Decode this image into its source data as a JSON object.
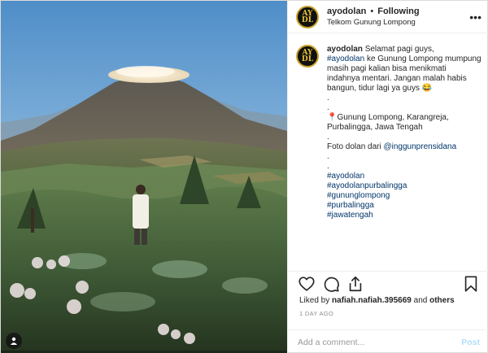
{
  "header": {
    "username": "ayodolan",
    "separator": "•",
    "follow_status": "Following",
    "location": "Telkom Gunung Lompong",
    "more_icon": "more-horizontal-icon"
  },
  "caption": {
    "author": "ayodolan",
    "text_1": "Selamat pagi guys,",
    "mention_hashtag": "#ayodolan",
    "text_2": "ke Gunung Lompong mumpung masih pagi kalian bisa menikmati indahnya mentari. Jangan malah habis bangun, tidur lagi ya guys 😂",
    "dot_1": ".",
    "dot_2": ".",
    "location_pin": "📍",
    "location_text": "Gunung Lompong, Karangreja, Purbalingga, Jawa Tengah",
    "dot_3": ".",
    "credit_text": "Foto dolan dari",
    "credit_user": "@inggunprensidana",
    "dot_4": ".",
    "dot_5": ".",
    "hashtags": [
      "#ayodolan",
      "#ayodolanpurbalingga",
      "#gununglompong",
      "#purbalingga",
      "#jawatengah"
    ]
  },
  "actions": {
    "like_icon": "heart-icon",
    "comment_icon": "comment-icon",
    "share_icon": "share-icon",
    "save_icon": "bookmark-icon"
  },
  "likes": {
    "prefix": "Liked by",
    "user": "nafiah.nafiah.395669",
    "suffix": "and",
    "others": "others"
  },
  "timestamp": "1 DAY AGO",
  "comment": {
    "placeholder": "Add a comment...",
    "post_label": "Post"
  },
  "avatar_text": "AYO DOLAN",
  "colors": {
    "link": "#003569",
    "muted": "#8e8e8e",
    "post_disabled": "#b2dffc",
    "avatar_gold": "#e8c233"
  }
}
